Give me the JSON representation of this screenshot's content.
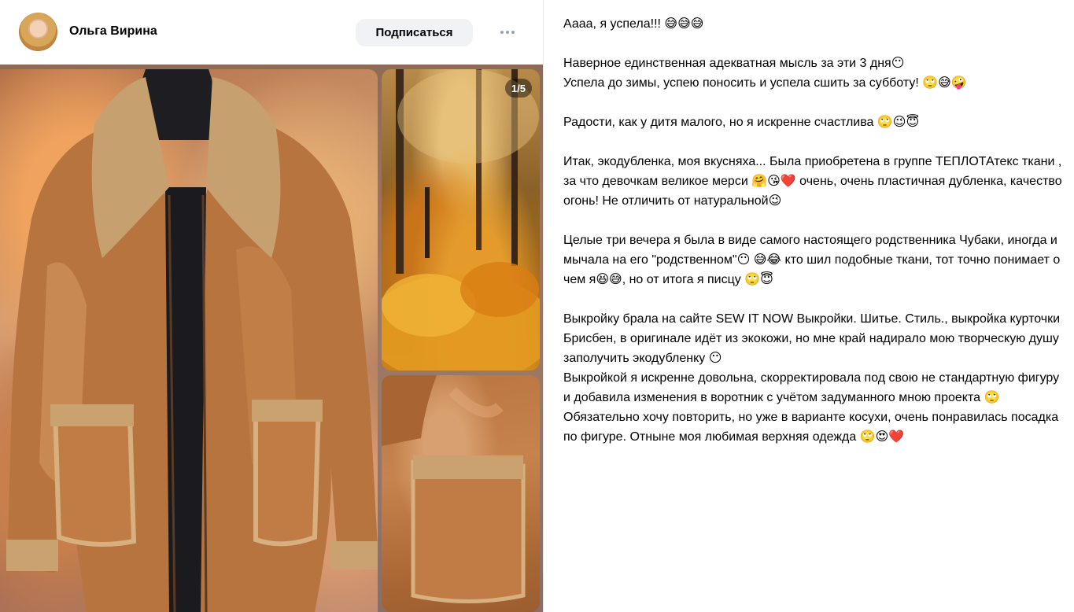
{
  "post": {
    "author": "Ольга Вирина",
    "follow_label": "Подписаться",
    "photo_counter": "1/5"
  },
  "icons": {
    "more": "more-horizontal-icon",
    "avatar": "user-avatar"
  },
  "colors": {
    "follow_bg": "#f0f2f5",
    "more_dots": "#99a2ad",
    "counter_bg": "rgba(0,0,0,0.45)"
  },
  "text": {
    "p1": "Аааа, я успела!!! 😅😅😅",
    "p2a": "Наверное единственная адекватная мысль за эти 3 дня😶",
    "p2b": "Успела до зимы, успею поносить и успела сшить за субботу! 🙄😅🤪",
    "p3": "Радости, как у дитя малого, но я искренне счастлива 🙄😉😇",
    "p4": "Итак, экодубленка, моя вкусняха... Была приобретена в группе ТЕПЛОТАтекс ткани , за что девочкам великое мерси 🤗😘❤️ очень, очень пластичная дубленка, качество огонь! Не отличить от натуральной😉",
    "p5": "Целые три вечера я была в виде самого настоящего родственника Чубаки, иногда и мычала на его \"родственном\"😶 😅😂 кто шил подобные ткани, тот точно понимает о чем я😆😅, но от итога я писцу 🙄😇",
    "p6a": "Выкройку брала на сайте SEW IT NOW Выкройки. Шитье. Стиль., выкройка курточки Брисбен, в оригинале идёт из экокожи, но мне край надирало мою творческую душу заполучить экодубленку 😶",
    "p6b": "Выкройкой я искренне довольна, скорректировала под свою не стандартную фигуру и добавила изменения в воротник с учётом задуманного мною проекта 🙄",
    "p6c": "Обязательно хочу повторить, но уже в варианте косухи, очень понравилась посадка по фигуре. Отныне моя любимая верхняя одежда 🙄😍❤️"
  }
}
